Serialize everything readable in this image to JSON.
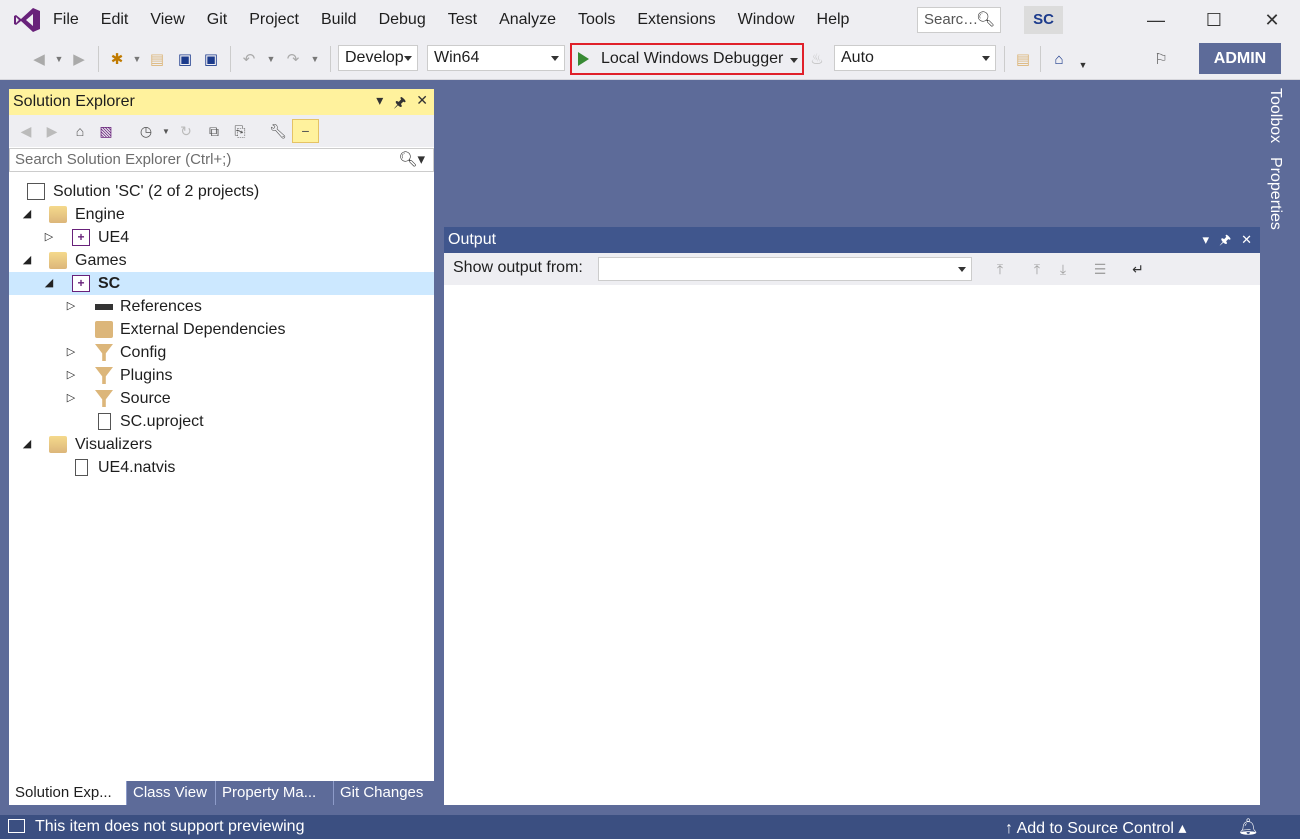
{
  "titlebar": {
    "menu": [
      "File",
      "Edit",
      "View",
      "Git",
      "Project",
      "Build",
      "Debug",
      "Test",
      "Analyze",
      "Tools",
      "Extensions",
      "Window",
      "Help"
    ],
    "search_placeholder": "Searc…",
    "project_badge": "SC"
  },
  "toolbar": {
    "configuration": "Develop",
    "platform": "Win64",
    "debugger": "Local Windows Debugger",
    "stack_frame": "Auto",
    "account_button": "ADMIN"
  },
  "solution_explorer": {
    "title": "Solution Explorer",
    "search_placeholder": "Search Solution Explorer (Ctrl+;)",
    "tree": [
      {
        "label": "Solution 'SC' (2 of 2 projects)"
      },
      {
        "label": "Engine"
      },
      {
        "label": "UE4"
      },
      {
        "label": "Games"
      },
      {
        "label": "SC"
      },
      {
        "label": "References"
      },
      {
        "label": "External Dependencies"
      },
      {
        "label": "Config"
      },
      {
        "label": "Plugins"
      },
      {
        "label": "Source"
      },
      {
        "label": "SC.uproject"
      },
      {
        "label": "Visualizers"
      },
      {
        "label": "UE4.natvis"
      }
    ],
    "tabs": [
      "Solution Exp...",
      "Class View",
      "Property Ma...",
      "Git Changes"
    ]
  },
  "output": {
    "title": "Output",
    "show_output_from_label": "Show output from:",
    "show_output_from_value": ""
  },
  "side_tabs": [
    "Toolbox",
    "Properties"
  ],
  "status_bar": {
    "message": "This item does not support previewing",
    "source_control": "Add to Source Control"
  },
  "colors": {
    "accent": "#68217a",
    "background": "#5d6b99",
    "tool_header_active": "#fff29d",
    "output_header": "#40568d",
    "status_bar": "#3b4f81",
    "highlight_border": "#e0202a"
  }
}
